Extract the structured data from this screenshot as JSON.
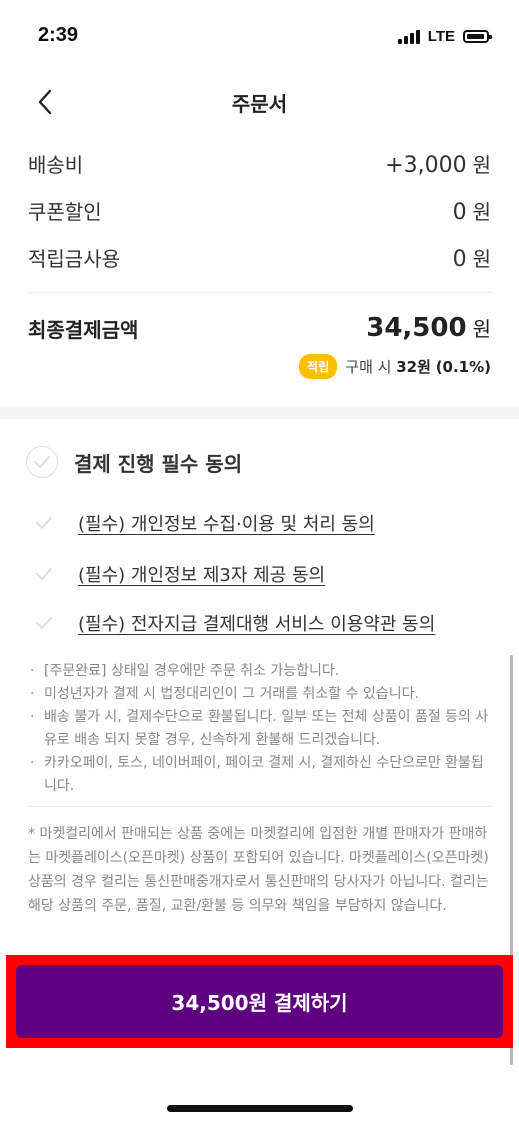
{
  "status_bar": {
    "time": "2:39",
    "network": "LTE"
  },
  "header": {
    "title": "주문서",
    "back_icon": "chevron-left-icon"
  },
  "summary": {
    "shipping_label": "배송비",
    "shipping_value": "+3,000",
    "coupon_label": "쿠폰할인",
    "coupon_value": "0",
    "points_label": "적립금사용",
    "points_value": "0",
    "unit": "원"
  },
  "total": {
    "label": "최종결제금액",
    "value": "34,500",
    "unit": "원",
    "point_badge": "적립",
    "point_prefix": "구매 시",
    "point_amount": "32원",
    "point_rate": "(0.1%)"
  },
  "agreement": {
    "all_label": "결제 진행 필수 동의",
    "items": [
      {
        "label": "(필수) 개인정보 수집·이용 및 처리 동의"
      },
      {
        "label": "(필수) 개인정보 제3자 제공 동의"
      },
      {
        "label": "(필수) 전자지급 결제대행 서비스 이용약관 동의"
      }
    ]
  },
  "notices": [
    "[주문완료] 상태일 경우에만 주문 취소 가능합니다.",
    "미성년자가 결제 시 법정대리인이 그 거래를 취소할 수 있습니다.",
    "배송 불가 시, 결제수단으로 환불됩니다. 일부 또는 전체 상품이 품절 등의 사유로 배송 되지 못할 경우, 신속하게 환불해 드리겠습니다.",
    "카카오페이, 토스, 네이버페이, 페이코 결제 시, 결제하신 수단으로만 환불됩니다."
  ],
  "disclaimer": "* 마켓컬리에서 판매되는 상품 중에는 마켓컬리에 입점한 개별 판매자가 판매하는 마켓플레이스(오픈마켓) 상품이 포함되어 있습니다. 마켓플레이스(오픈마켓) 상품의 경우 컬리는 통신판매중개자로서 통신판매의 당사자가 아닙니다. 컬리는 해당 상품의 주문, 품질, 교환/환불 등 의무와 책임을 부담하지 않습니다.",
  "pay_button": {
    "label": "34,500원 결제하기"
  },
  "colors": {
    "brand": "#5F0080",
    "point_badge": "#FFBF00",
    "highlight": "#FF0000"
  }
}
